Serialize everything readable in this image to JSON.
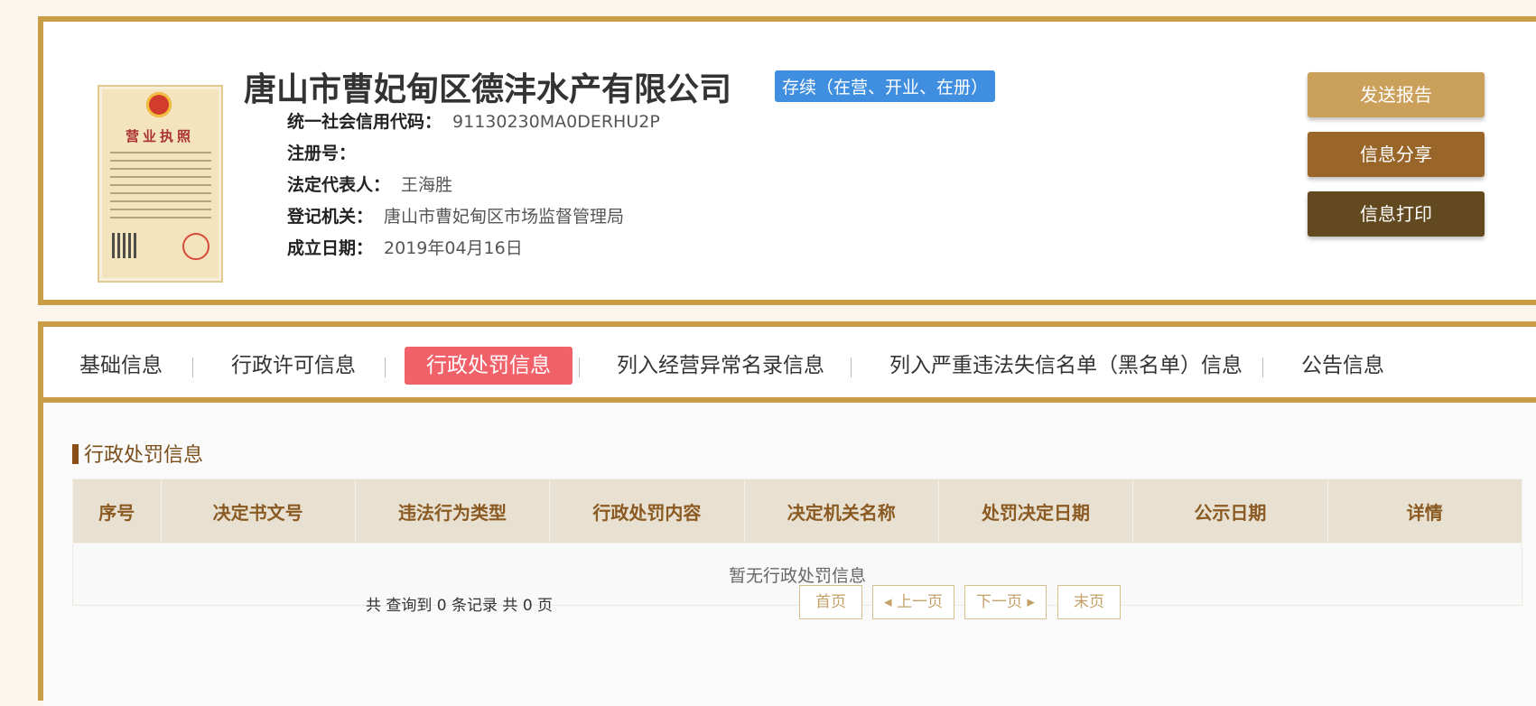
{
  "company": {
    "name": "唐山市曹妃甸区德沣水产有限公司",
    "status": "存续（在营、开业、在册）",
    "credit_code_label": "统一社会信用代码：",
    "credit_code": "91130230MA0DERHU2P",
    "reg_no_label": "注册号：",
    "reg_no": "",
    "legal_rep_label": "法定代表人：",
    "legal_rep": "王海胜",
    "authority_label": "登记机关：",
    "authority": "唐山市曹妃甸区市场监督管理局",
    "founded_label": "成立日期：",
    "founded": "2019年04月16日",
    "license_title": "营业执照"
  },
  "actions": {
    "send_report": "发送报告",
    "share": "信息分享",
    "print": "信息打印"
  },
  "tabs": [
    {
      "label": "基础信息"
    },
    {
      "label": "行政许可信息"
    },
    {
      "label": "行政处罚信息",
      "active": true
    },
    {
      "label": "列入经营异常名录信息"
    },
    {
      "label": "列入严重违法失信名单（黑名单）信息"
    },
    {
      "label": "公告信息"
    }
  ],
  "section": {
    "title": "行政处罚信息",
    "columns": [
      "序号",
      "决定书文号",
      "违法行为类型",
      "行政处罚内容",
      "决定机关名称",
      "处罚决定日期",
      "公示日期",
      "详情"
    ],
    "empty_text": "暂无行政处罚信息"
  },
  "pager": {
    "summary": "共 查询到 0 条记录 共 0 页",
    "first": "首页",
    "prev": "◂ 上一页",
    "next": "下一页 ▸",
    "last": "末页"
  },
  "colors": {
    "border_gold": "#c99d45",
    "status_blue": "#3f8ee0",
    "active_tab": "#f0616a",
    "btn_send": "#cba05a",
    "btn_share": "#9a6528",
    "btn_print": "#62491f"
  }
}
